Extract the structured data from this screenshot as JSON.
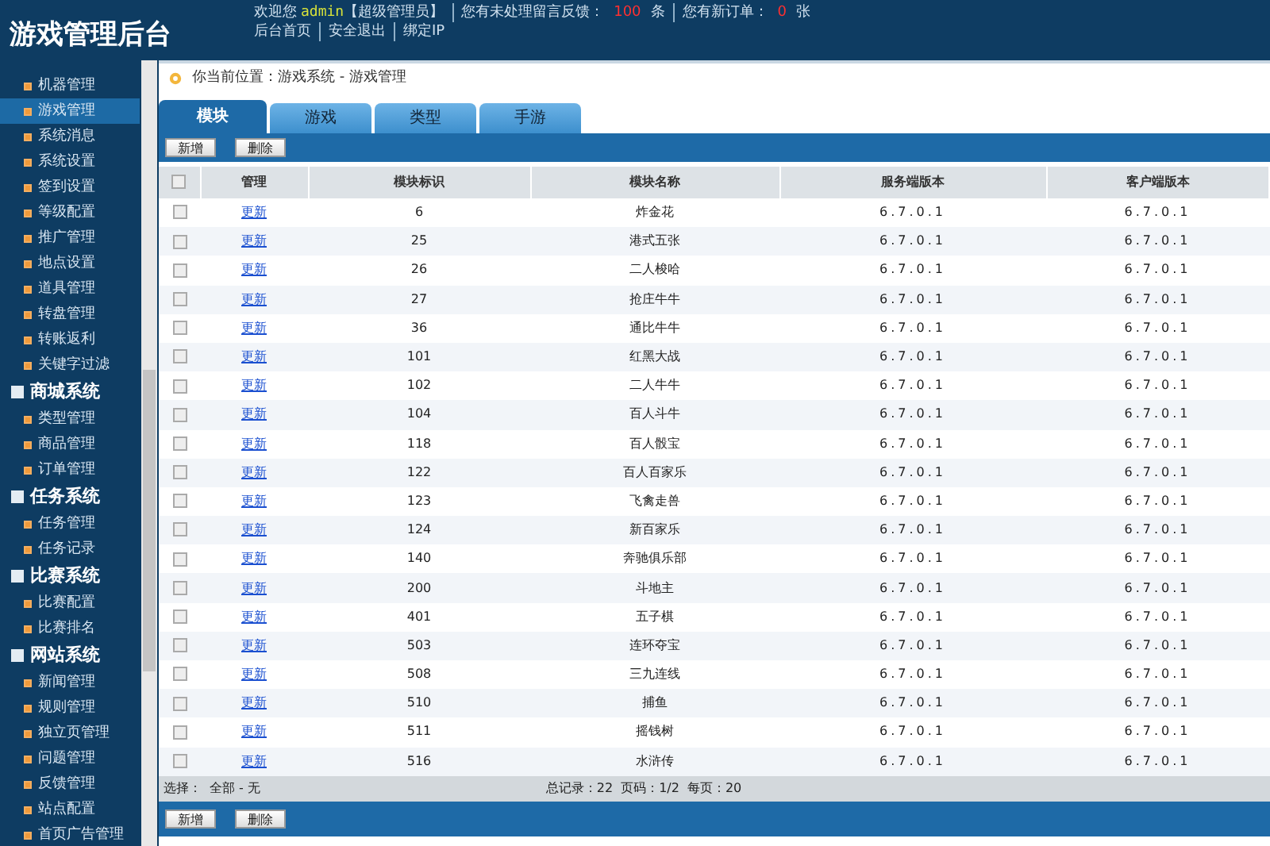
{
  "header": {
    "title": "游戏管理后台",
    "welcome": "欢迎您",
    "user": "admin",
    "role": "【超级管理员】",
    "feedback_label": "您有未处理留言反馈：",
    "feedback_count": "100",
    "feedback_unit": "条",
    "orders_label": "您有新订单：",
    "orders_count": "0",
    "orders_unit": "张",
    "links": [
      "后台首页",
      "安全退出",
      "绑定IP"
    ]
  },
  "sidebar": {
    "sections": [
      {
        "items": [
          {
            "label": "机器管理",
            "selected": false
          },
          {
            "label": "游戏管理",
            "selected": true
          },
          {
            "label": "系统消息",
            "selected": false
          },
          {
            "label": "系统设置",
            "selected": false
          },
          {
            "label": "签到设置",
            "selected": false
          },
          {
            "label": "等级配置",
            "selected": false
          },
          {
            "label": "推广管理",
            "selected": false
          },
          {
            "label": "地点设置",
            "selected": false
          },
          {
            "label": "道具管理",
            "selected": false
          },
          {
            "label": "转盘管理",
            "selected": false
          },
          {
            "label": "转账返利",
            "selected": false
          },
          {
            "label": "关键字过滤",
            "selected": false
          }
        ]
      },
      {
        "title": "商城系统",
        "items": [
          {
            "label": "类型管理",
            "selected": false
          },
          {
            "label": "商品管理",
            "selected": false
          },
          {
            "label": "订单管理",
            "selected": false
          }
        ]
      },
      {
        "title": "任务系统",
        "items": [
          {
            "label": "任务管理",
            "selected": false
          },
          {
            "label": "任务记录",
            "selected": false
          }
        ]
      },
      {
        "title": "比赛系统",
        "items": [
          {
            "label": "比赛配置",
            "selected": false
          },
          {
            "label": "比赛排名",
            "selected": false
          }
        ]
      },
      {
        "title": "网站系统",
        "items": [
          {
            "label": "新闻管理",
            "selected": false
          },
          {
            "label": "规则管理",
            "selected": false
          },
          {
            "label": "独立页管理",
            "selected": false
          },
          {
            "label": "问题管理",
            "selected": false
          },
          {
            "label": "反馈管理",
            "selected": false
          },
          {
            "label": "站点配置",
            "selected": false
          },
          {
            "label": "首页广告管理",
            "selected": false
          }
        ]
      }
    ]
  },
  "breadcrumb": "你当前位置：游戏系统 - 游戏管理",
  "tabs": [
    {
      "label": "模块",
      "selected": true
    },
    {
      "label": "游戏",
      "selected": false
    },
    {
      "label": "类型",
      "selected": false
    },
    {
      "label": "手游",
      "selected": false
    }
  ],
  "toolbar": [
    "新增",
    "删除"
  ],
  "table": {
    "select_all_checked": false,
    "columns": [
      "管理",
      "模块标识",
      "模块名称",
      "服务端版本",
      "客户端版本"
    ],
    "rows": [
      {
        "checked": false,
        "action": "更新",
        "id": "6",
        "name": "炸金花",
        "server": "6.7.0.1",
        "client": "6.7.0.1"
      },
      {
        "checked": false,
        "action": "更新",
        "id": "25",
        "name": "港式五张",
        "server": "6.7.0.1",
        "client": "6.7.0.1"
      },
      {
        "checked": false,
        "action": "更新",
        "id": "26",
        "name": "二人梭哈",
        "server": "6.7.0.1",
        "client": "6.7.0.1"
      },
      {
        "checked": false,
        "action": "更新",
        "id": "27",
        "name": "抢庄牛牛",
        "server": "6.7.0.1",
        "client": "6.7.0.1"
      },
      {
        "checked": false,
        "action": "更新",
        "id": "36",
        "name": "通比牛牛",
        "server": "6.7.0.1",
        "client": "6.7.0.1"
      },
      {
        "checked": false,
        "action": "更新",
        "id": "101",
        "name": "红黑大战",
        "server": "6.7.0.1",
        "client": "6.7.0.1"
      },
      {
        "checked": false,
        "action": "更新",
        "id": "102",
        "name": "二人牛牛",
        "server": "6.7.0.1",
        "client": "6.7.0.1"
      },
      {
        "checked": false,
        "action": "更新",
        "id": "104",
        "name": "百人斗牛",
        "server": "6.7.0.1",
        "client": "6.7.0.1"
      },
      {
        "checked": false,
        "action": "更新",
        "id": "118",
        "name": "百人骰宝",
        "server": "6.7.0.1",
        "client": "6.7.0.1"
      },
      {
        "checked": false,
        "action": "更新",
        "id": "122",
        "name": "百人百家乐",
        "server": "6.7.0.1",
        "client": "6.7.0.1"
      },
      {
        "checked": false,
        "action": "更新",
        "id": "123",
        "name": "飞禽走兽",
        "server": "6.7.0.1",
        "client": "6.7.0.1"
      },
      {
        "checked": false,
        "action": "更新",
        "id": "124",
        "name": "新百家乐",
        "server": "6.7.0.1",
        "client": "6.7.0.1"
      },
      {
        "checked": false,
        "action": "更新",
        "id": "140",
        "name": "奔驰俱乐部",
        "server": "6.7.0.1",
        "client": "6.7.0.1"
      },
      {
        "checked": false,
        "action": "更新",
        "id": "200",
        "name": "斗地主",
        "server": "6.7.0.1",
        "client": "6.7.0.1"
      },
      {
        "checked": false,
        "action": "更新",
        "id": "401",
        "name": "五子棋",
        "server": "6.7.0.1",
        "client": "6.7.0.1"
      },
      {
        "checked": false,
        "action": "更新",
        "id": "503",
        "name": "连环夺宝",
        "server": "6.7.0.1",
        "client": "6.7.0.1"
      },
      {
        "checked": false,
        "action": "更新",
        "id": "508",
        "name": "三九连线",
        "server": "6.7.0.1",
        "client": "6.7.0.1"
      },
      {
        "checked": false,
        "action": "更新",
        "id": "510",
        "name": "捕鱼",
        "server": "6.7.0.1",
        "client": "6.7.0.1"
      },
      {
        "checked": false,
        "action": "更新",
        "id": "511",
        "name": "摇钱树",
        "server": "6.7.0.1",
        "client": "6.7.0.1"
      },
      {
        "checked": false,
        "action": "更新",
        "id": "516",
        "name": "水浒传",
        "server": "6.7.0.1",
        "client": "6.7.0.1"
      }
    ]
  },
  "footer": {
    "select": "选择：",
    "all": "全部",
    "separator": "-",
    "none": "无",
    "total": "总记录：22",
    "page": "页码：1/2",
    "per_page": "每页：20"
  },
  "bottom_toolbar": [
    "新增",
    "删除"
  ]
}
